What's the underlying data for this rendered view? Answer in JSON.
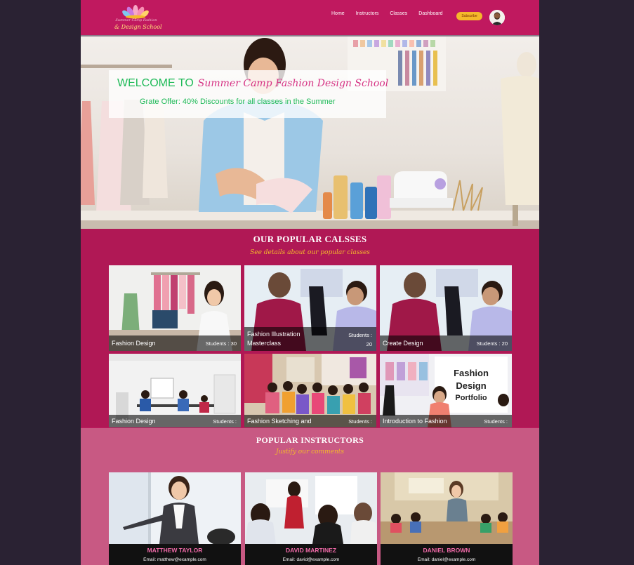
{
  "logo": {
    "line1": "Summer Camp Fashion",
    "line2": "& Design School"
  },
  "nav": {
    "items": [
      "Home",
      "Instructors",
      "Classes",
      "Dashboard"
    ],
    "button_label": "Subscribe"
  },
  "hero": {
    "welcome": "WELCOME TO",
    "school_name": "Summer Camp Fashion Design School",
    "offer": "Grate Offer: 40% Discounts for all classes in the Summer"
  },
  "classes_section": {
    "title": "OUR POPULAR CALSSES",
    "subtitle": "See details about our popular classes",
    "cards": [
      {
        "title": "Fashion Design",
        "students": "Students : 30"
      },
      {
        "title": "Fashion Illustration Masterclass",
        "students": "Students : 20"
      },
      {
        "title": "Create Design",
        "students": "Students : 20"
      },
      {
        "title": "Fashion Design",
        "students": "Students :"
      },
      {
        "title": "Fashion Sketching and",
        "students": "Students :"
      },
      {
        "title": "Introduction to Fashion",
        "students": "Students :"
      }
    ]
  },
  "instructors_section": {
    "title": "POPULAR INSTRUCTORS",
    "subtitle": "Justify our comments",
    "cards": [
      {
        "name": "MATTHEW TAYLOR",
        "email": "Email: matthew@example.com"
      },
      {
        "name": "DAVID MARTINEZ",
        "email": "Email: david@example.com"
      },
      {
        "name": "DANIEL BROWN",
        "email": "Email: daniel@example.com"
      }
    ]
  },
  "colors": {
    "brand": "#c0195f",
    "section_dark": "#b01855",
    "section_light": "#c85983",
    "accent": "#f4b92b",
    "green": "#1fba58"
  }
}
